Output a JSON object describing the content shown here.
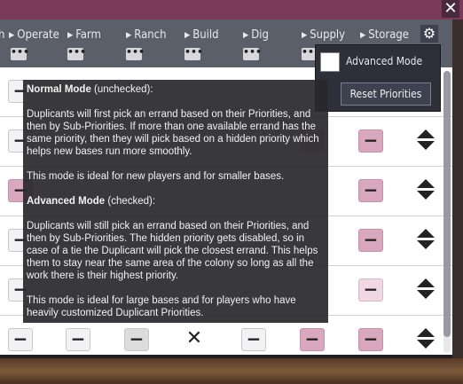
{
  "window": {
    "close_glyph": "✕"
  },
  "columns": [
    {
      "label": "h"
    },
    {
      "label": "Operate"
    },
    {
      "label": "Farm"
    },
    {
      "label": "Ranch"
    },
    {
      "label": "Build"
    },
    {
      "label": "Dig"
    },
    {
      "label": "Supply"
    },
    {
      "label": "Storage"
    }
  ],
  "header": {
    "dots": "•••",
    "gear_icon": "gear-icon"
  },
  "advanced": {
    "label": "Advanced Mode",
    "checked": false,
    "reset_label": "Reset Priorities"
  },
  "tooltip": {
    "normal_title": "Normal Mode",
    "normal_suffix": " (unchecked):",
    "normal_body": "Duplicants will first pick an errand based on their Priorities, and then by Sub-Priorities. If more than one available errand has the same priority, then they will pick based on a hidden priority which helps new bases run more smoothly.",
    "normal_note": "This mode is ideal for new players and for smaller bases.",
    "adv_title": "Advanced Mode",
    "adv_suffix": " (checked):",
    "adv_body": "Duplicants will still pick an errand based on their Priorities, and then by Sub-Priorities. The hidden priority gets disabled, so in case of a tie the Duplicant will pick the closest errand. This helps them to stay near the same area of the colony so long as all the work there is their highest priority.",
    "adv_note": "This mode is ideal for large bases and for players who have heavily customized Duplicant Priorities."
  },
  "cell_glyph": "−",
  "x_glyph": "✕"
}
